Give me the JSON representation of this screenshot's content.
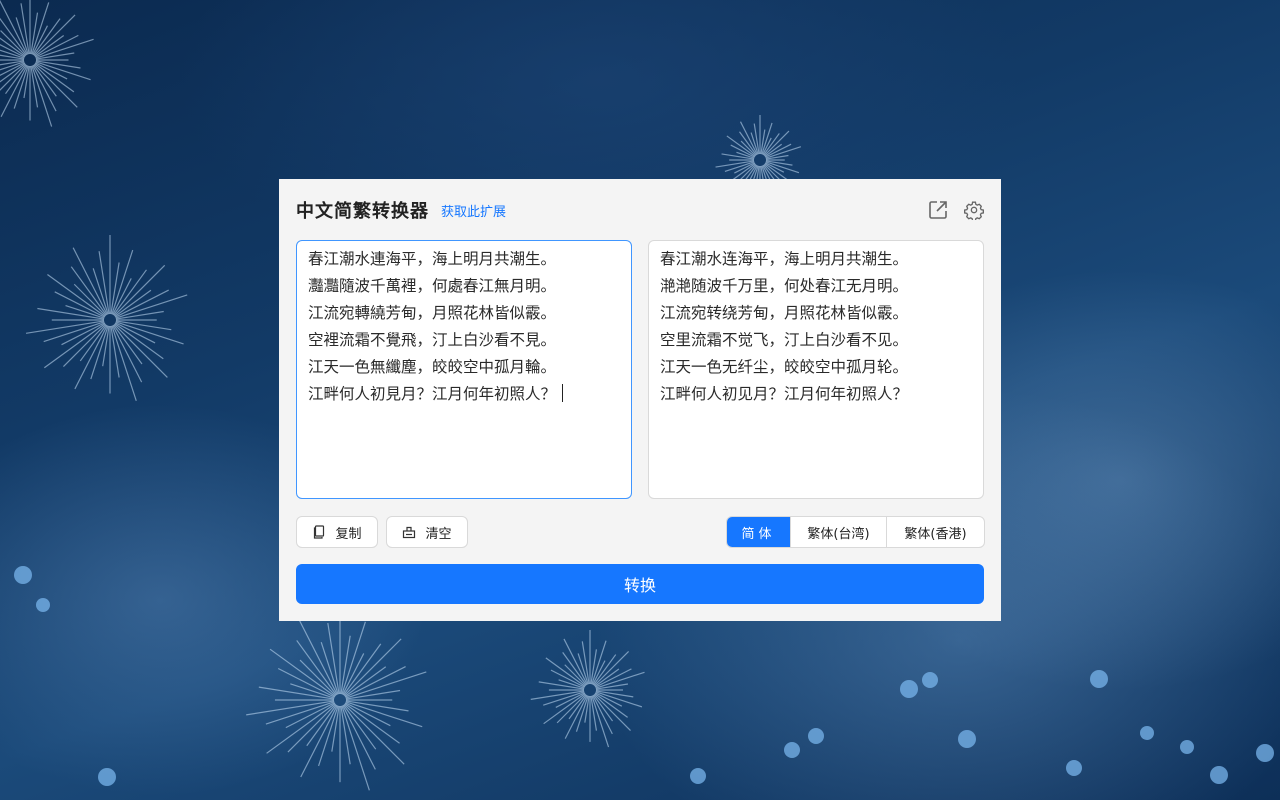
{
  "app": {
    "title": "中文简繁转换器",
    "get_extension_link": "获取此扩展"
  },
  "header_icons": [
    "external-link-icon",
    "gear-icon"
  ],
  "input_text": "春江潮水連海平，海上明月共潮生。\n灩灩隨波千萬裡，何處春江無月明。\n江流宛轉繞芳甸，月照花林皆似霰。\n空裡流霜不覺飛，汀上白沙看不見。\n江天一色無纖塵，皎皎空中孤月輪。\n江畔何人初見月？江月何年初照人？",
  "output_text": "春江潮水连海平，海上明月共潮生。\n滟滟随波千万里，何处春江无月明。\n江流宛转绕芳甸，月照花林皆似霰。\n空里流霜不觉飞，汀上白沙看不见。\n江天一色无纤尘，皎皎空中孤月轮。\n江畔何人初见月？江月何年初照人？",
  "buttons": {
    "copy": "复制",
    "clear": "清空",
    "convert": "转换"
  },
  "modes": {
    "selected": "简体",
    "options": [
      "简体",
      "繁体(台湾)",
      "繁体(香港)"
    ]
  },
  "colors": {
    "accent": "#1677ff",
    "panel_bg": "#f4f4f4"
  }
}
